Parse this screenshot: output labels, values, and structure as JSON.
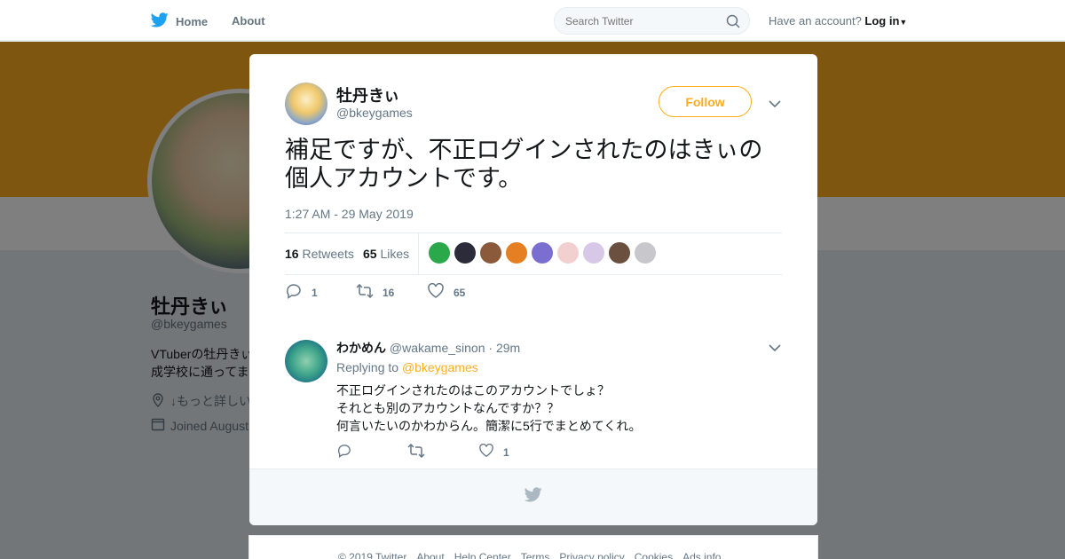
{
  "nav": {
    "home_label": "Home",
    "about_label": "About",
    "search_placeholder": "Search Twitter",
    "account_prefix": "Have an account?",
    "login_label": "Log in"
  },
  "profile": {
    "name": "牡丹きぃ",
    "handle": "@bkeygames",
    "bio": "VTuberの牡丹きぃ 成学校に通ってま",
    "location": "↓もっと詳しい",
    "joined": "Joined August"
  },
  "tweet": {
    "name": "牡丹きぃ",
    "handle": "@bkeygames",
    "follow_label": "Follow",
    "text": "補足ですが、不正ログインされたのはきぃの個人アカウントです。",
    "timestamp": "1:27 AM - 29 May 2019",
    "retweets_count": "16",
    "retweets_label": "Retweets",
    "likes_count": "65",
    "likes_label": "Likes",
    "actions": {
      "replies": "1",
      "retweets": "16",
      "likes": "65"
    }
  },
  "likers": [
    {
      "color": "#2aa84a"
    },
    {
      "color": "#2b2b3a"
    },
    {
      "color": "#8a5a3a"
    },
    {
      "color": "#e67e22"
    },
    {
      "color": "#7a6fd0"
    },
    {
      "color": "#f2d0d0"
    },
    {
      "color": "#d8c8e8"
    },
    {
      "color": "#6b4f3f"
    },
    {
      "color": "#c8c8cc"
    }
  ],
  "reply": {
    "name": "わかめん",
    "handle": "@wakame_sinon",
    "time": "· 29m",
    "replying_prefix": "Replying to",
    "replying_to": "@bkeygames",
    "lines": [
      "不正ログインされたのはこのアカウントでしょ？",
      "それとも別のアカウントなんですか？？",
      "何言いたいのかわからん。簡潔に5行でまとめてくれ。"
    ],
    "actions": {
      "likes": "1"
    }
  },
  "footer": {
    "links": [
      "© 2019 Twitter",
      "About",
      "Help Center",
      "Terms",
      "Privacy policy",
      "Cookies",
      "Ads info"
    ]
  },
  "colors": {
    "accent": "#ffad1f",
    "twitter_blue": "#1da1f2",
    "muted": "#657786"
  }
}
